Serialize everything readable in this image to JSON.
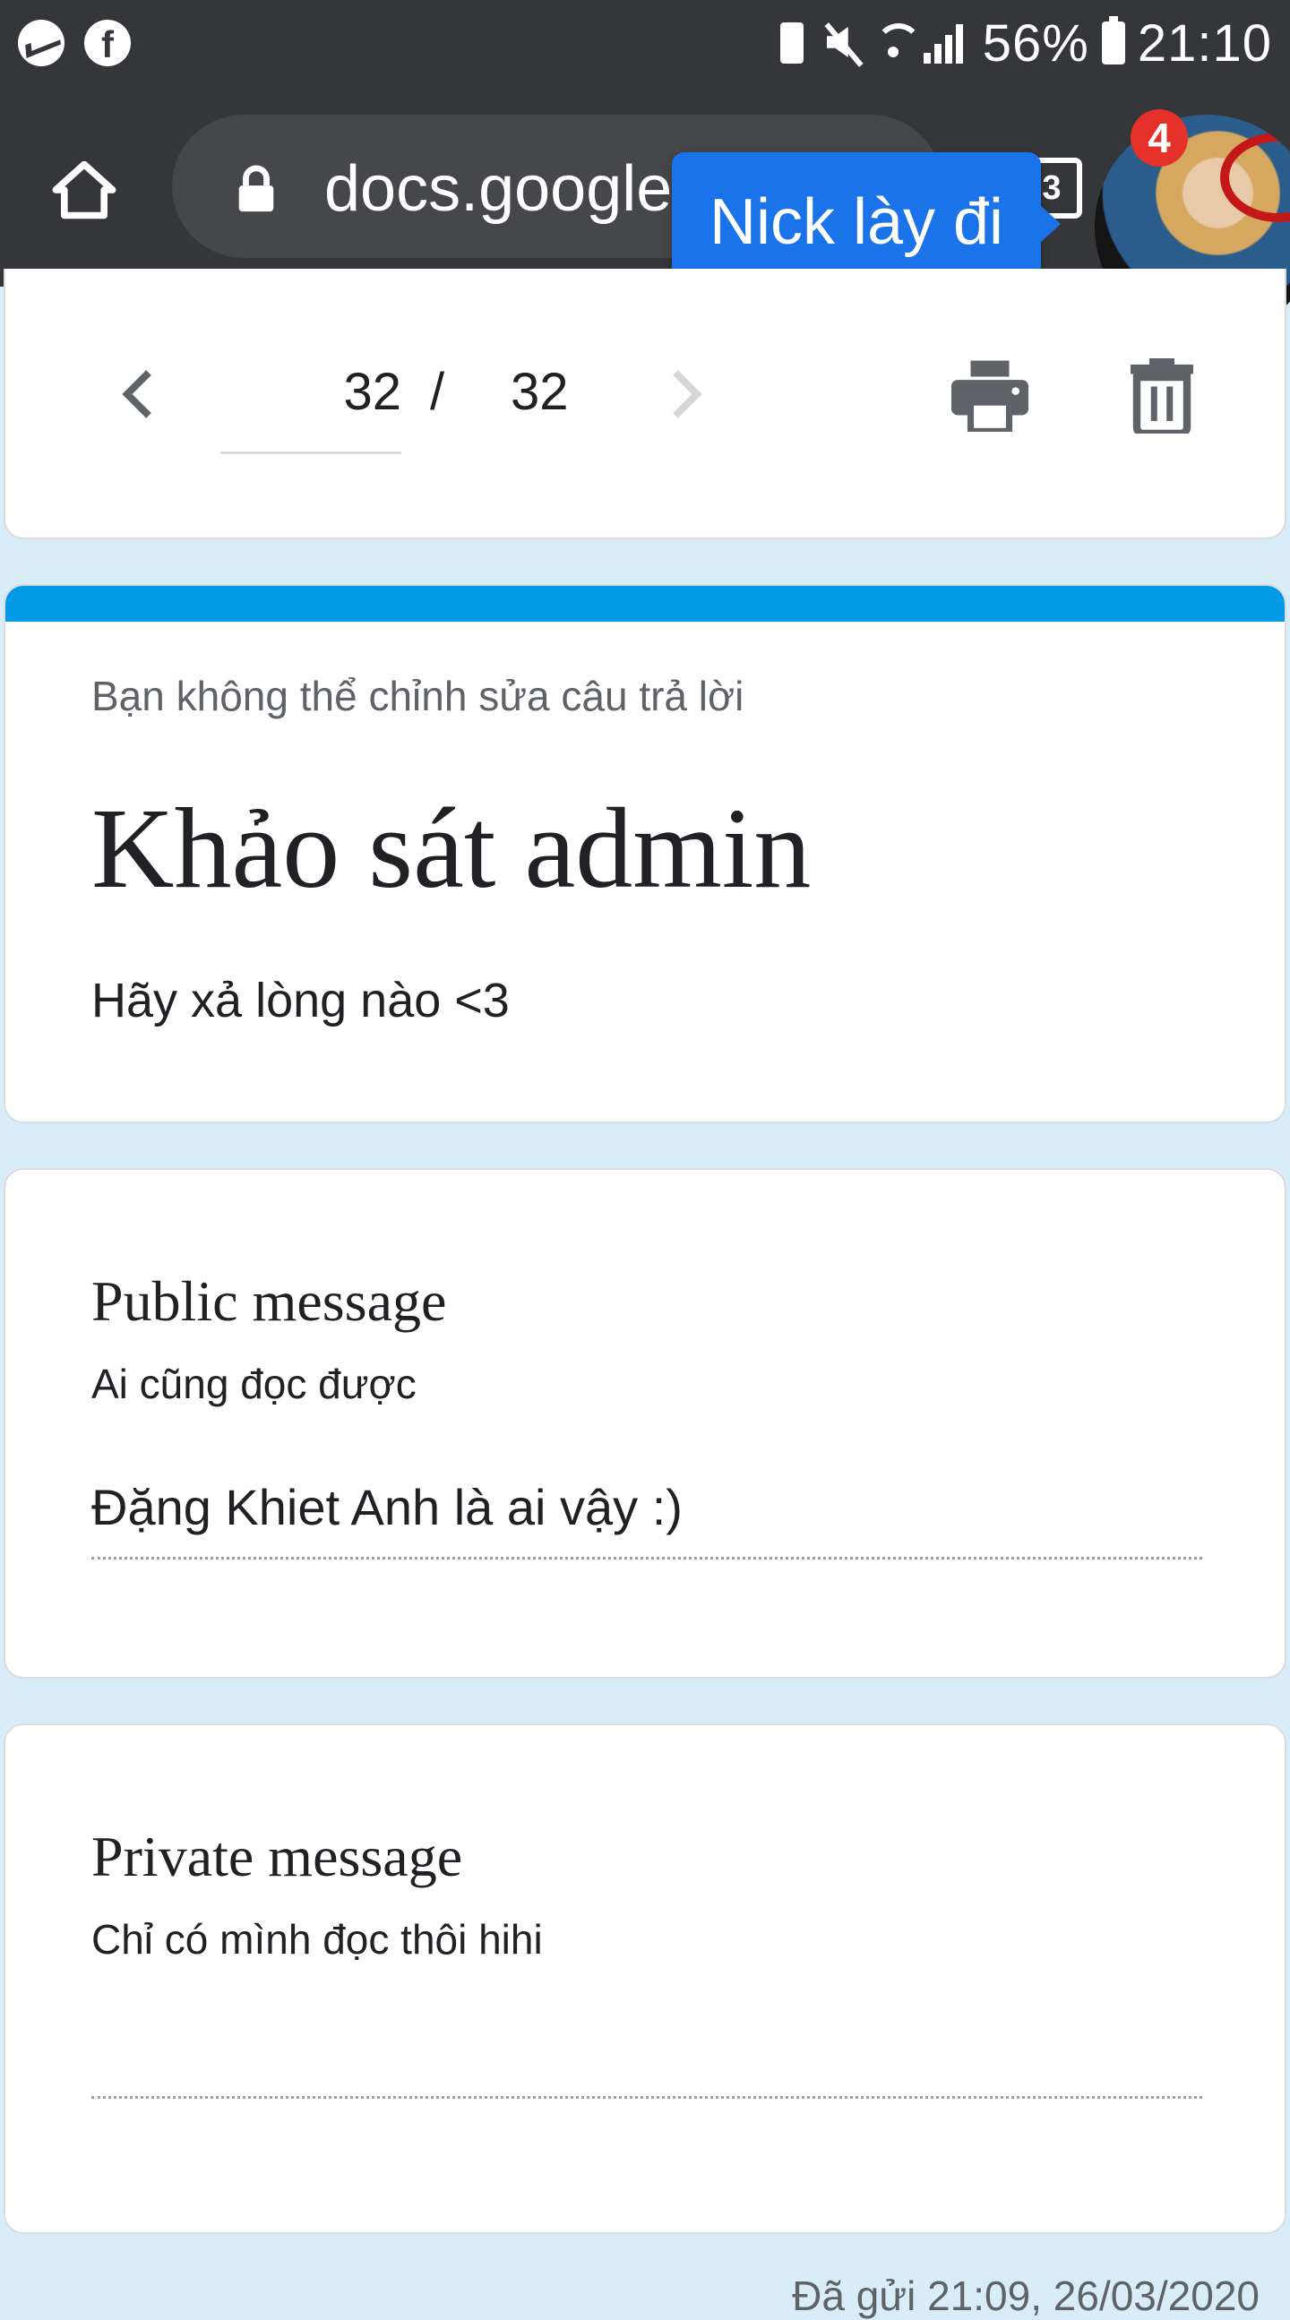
{
  "status_bar": {
    "battery_percent": "56%",
    "time": "21:10",
    "icons": [
      "messenger-icon",
      "facebook-icon",
      "battery-saver-icon",
      "mute-icon",
      "wifi-icon",
      "signal-icon",
      "battery-icon"
    ]
  },
  "browser": {
    "url": "docs.google.com",
    "tab_count": "3"
  },
  "chat_head": {
    "tooltip": "Nick lày đi",
    "badge_count": "4"
  },
  "response_nav": {
    "current": "32",
    "separator": "/",
    "total": "32"
  },
  "form": {
    "notice": "Bạn không thể chỉnh sửa câu trả lời",
    "title": "Khảo sát admin",
    "description": "Hãy xả lòng nào <3",
    "accent_color": "#039be5"
  },
  "questions": [
    {
      "title": "Public message",
      "help": "Ai cũng đọc được",
      "answer": "Đặng Khiet Anh là ai vậy :)"
    },
    {
      "title": "Private message",
      "help": "Chỉ có mình đọc thôi hihi",
      "answer": ""
    }
  ],
  "footer": {
    "submitted": "Đã gửi 21:09, 26/03/2020"
  }
}
